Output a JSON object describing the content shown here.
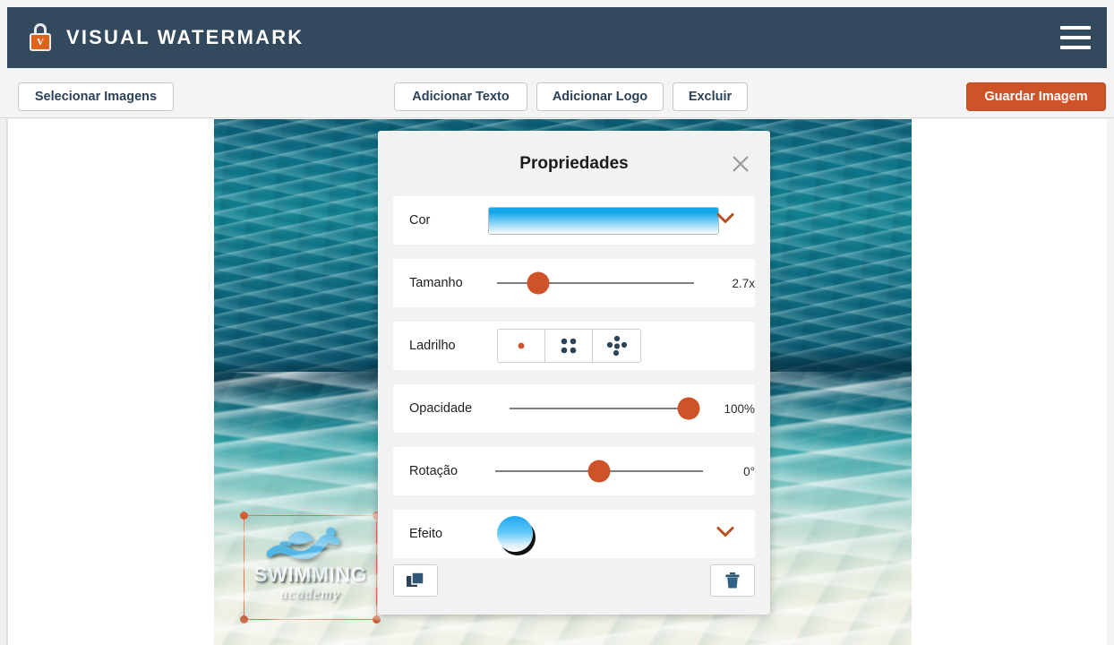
{
  "header": {
    "brand_title": "VISUAL WATERMARK",
    "logo_letter": "V",
    "logo_icon": "padlock-icon",
    "menu_icon": "hamburger-menu-icon",
    "bg_color": "#33495e",
    "accent_color": "#e2621b"
  },
  "toolbar": {
    "select_images": "Selecionar Imagens",
    "add_text": "Adicionar Texto",
    "add_logo": "Adicionar Logo",
    "delete": "Excluir",
    "save_image": "Guardar Imagem",
    "save_color": "#cf5329"
  },
  "watermark": {
    "word": "SWIMMING",
    "sub": "academy",
    "icon": "swimmer-icon",
    "selected": true,
    "handle_color": "#cf5329"
  },
  "panel": {
    "title": "Propriedades",
    "close_icon": "close-icon",
    "rows": {
      "color": {
        "label": "Cor",
        "swatch_top": "#14a7ec",
        "swatch_bottom": "#ffffff",
        "chevron_icon": "chevron-down-icon"
      },
      "size": {
        "label": "Tamanho",
        "value": "2.7x",
        "percent": 21
      },
      "tile": {
        "label": "Ladrilho",
        "options": [
          {
            "name": "tile-single-icon",
            "selected": true
          },
          {
            "name": "tile-grid4-icon",
            "selected": false
          },
          {
            "name": "tile-diamond5-icon",
            "selected": false
          }
        ],
        "selected_color": "#cf5329",
        "unselected_color": "#2c4257"
      },
      "opacity": {
        "label": "Opacidade",
        "value": "100%",
        "percent": 100
      },
      "rotation": {
        "label": "Rotação",
        "value": "0°",
        "percent": 50
      },
      "effect": {
        "label": "Efeito",
        "preview": "gradient-shadow-ball",
        "chevron_icon": "chevron-down-icon"
      }
    },
    "actions": {
      "duplicate_icon": "duplicate-icon",
      "delete_icon": "trash-icon"
    }
  }
}
